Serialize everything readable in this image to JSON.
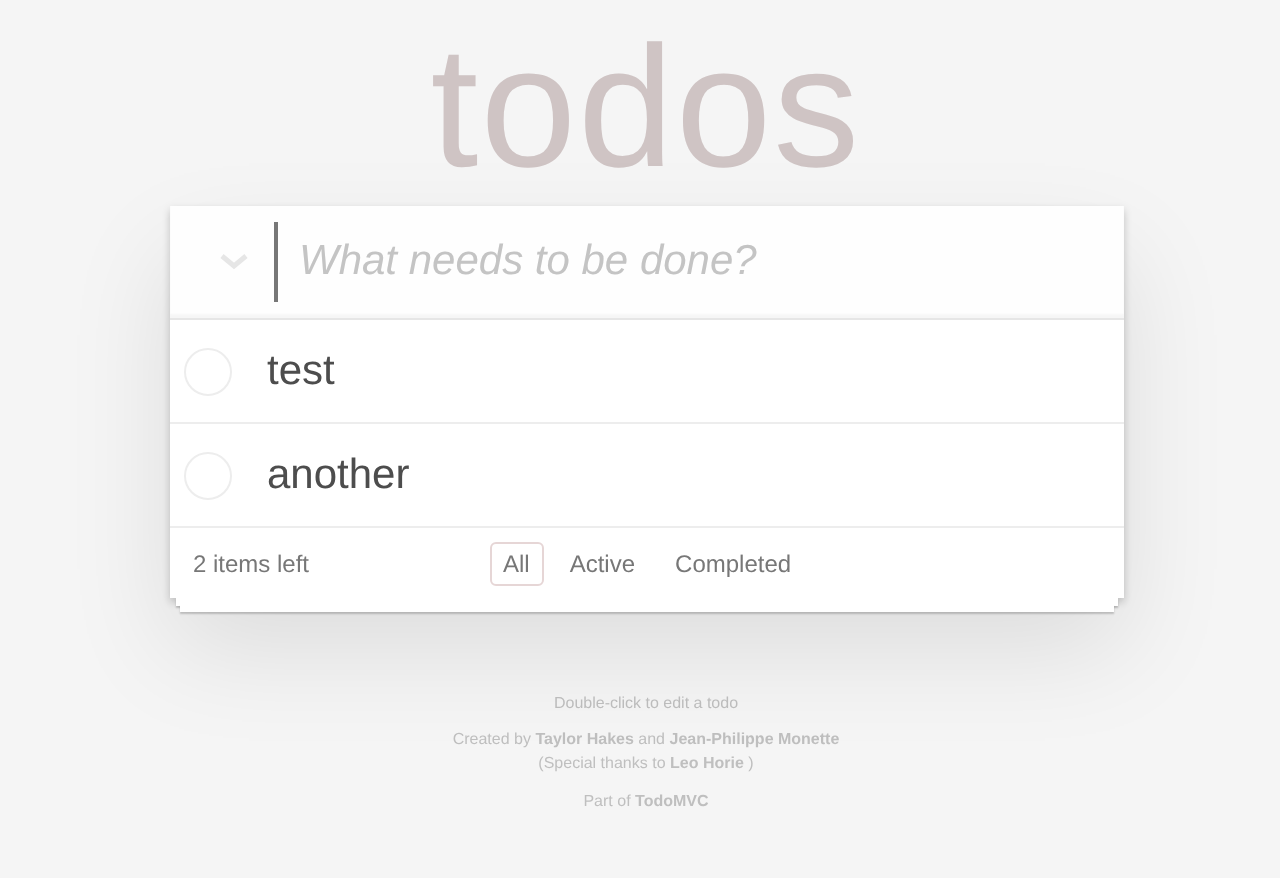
{
  "title": "todos",
  "new_todo": {
    "placeholder": "What needs to be done?"
  },
  "todos": [
    {
      "text": "test",
      "completed": false
    },
    {
      "text": "another",
      "completed": false
    }
  ],
  "footer": {
    "count": "2 items left",
    "filters": [
      {
        "label": "All",
        "selected": true
      },
      {
        "label": "Active",
        "selected": false
      },
      {
        "label": "Completed",
        "selected": false
      }
    ]
  },
  "info": [
    [
      {
        "text": "Double-click to edit a todo",
        "link": false
      }
    ],
    [
      {
        "text": "Created by",
        "link": false
      },
      {
        "text": "Taylor Hakes",
        "link": true
      },
      {
        "text": "and",
        "link": false
      },
      {
        "text": "Jean-Philippe Monette",
        "link": true
      }
    ],
    [
      {
        "text": "(Special thanks to",
        "link": false
      },
      {
        "text": "Leo Horie",
        "link": true
      },
      {
        "text": ")",
        "link": false
      }
    ],
    [
      {
        "text": "Part of",
        "link": false
      },
      {
        "text": "TodoMVC",
        "link": true
      }
    ]
  ]
}
